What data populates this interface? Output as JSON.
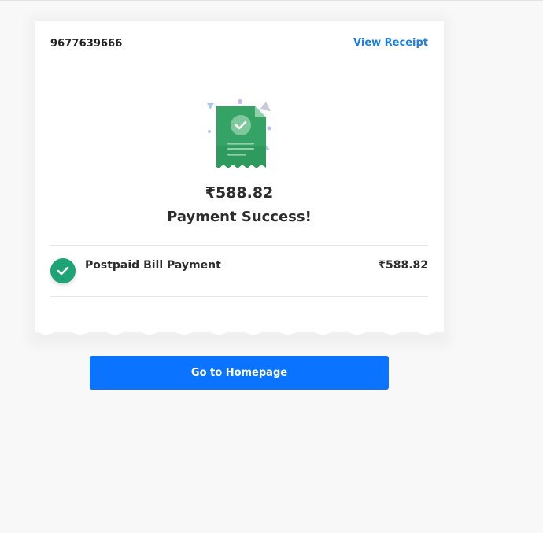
{
  "receipt": {
    "phone_number": "9677639666",
    "view_receipt_label": "View Receipt",
    "amount": "₹588.82",
    "status_text": "Payment Success!",
    "transaction": {
      "label": "Postpaid Bill Payment",
      "amount": "₹588.82"
    }
  },
  "actions": {
    "homepage_label": "Go to Homepage"
  },
  "icons": {
    "receipt": "receipt-success-icon",
    "check": "check-icon"
  },
  "colors": {
    "accent": "#0a73ff",
    "link": "#1a7fe0",
    "success": "#1ea377",
    "receipt_green": "#2e9a5e"
  }
}
